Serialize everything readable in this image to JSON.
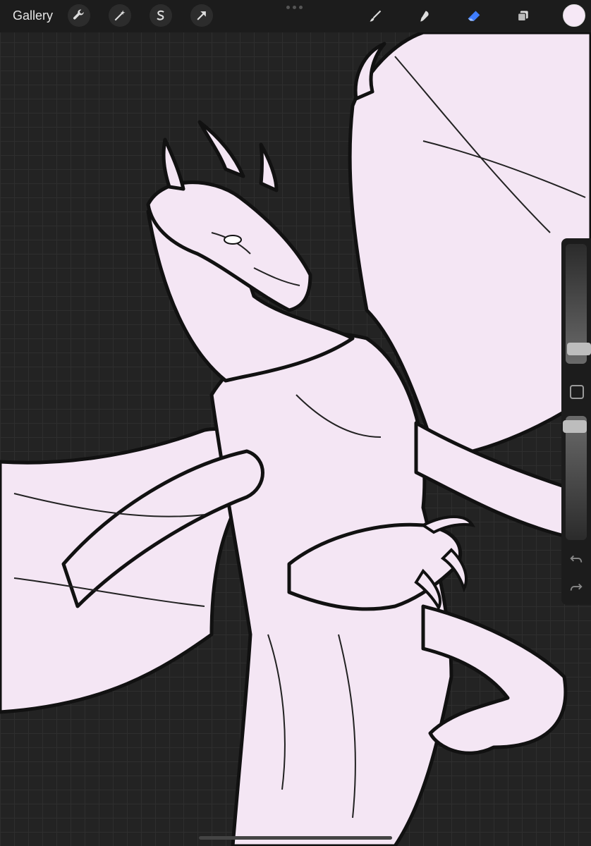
{
  "topbar": {
    "gallery_label": "Gallery",
    "left_tools": [
      "wrench-icon",
      "magic-wand-icon",
      "selection-s-icon",
      "transform-arrow-icon"
    ],
    "right_tools": [
      "brush-icon",
      "smudge-icon",
      "eraser-icon",
      "layers-icon"
    ],
    "active_tool": "eraser-icon",
    "color_swatch": "#f6e8f6"
  },
  "colors": {
    "canvas_bg": "#232323",
    "line_art_fill": "#f4e6f4",
    "outline": "#111111",
    "active_tool": "#3f7dff"
  },
  "sidebar": {
    "brush_size_level": 0.18,
    "opacity_level": 0.97,
    "icons": [
      "modifier-square-icon",
      "undo-icon",
      "redo-icon"
    ]
  },
  "canvas": {
    "subject": "dragon-line-art"
  }
}
